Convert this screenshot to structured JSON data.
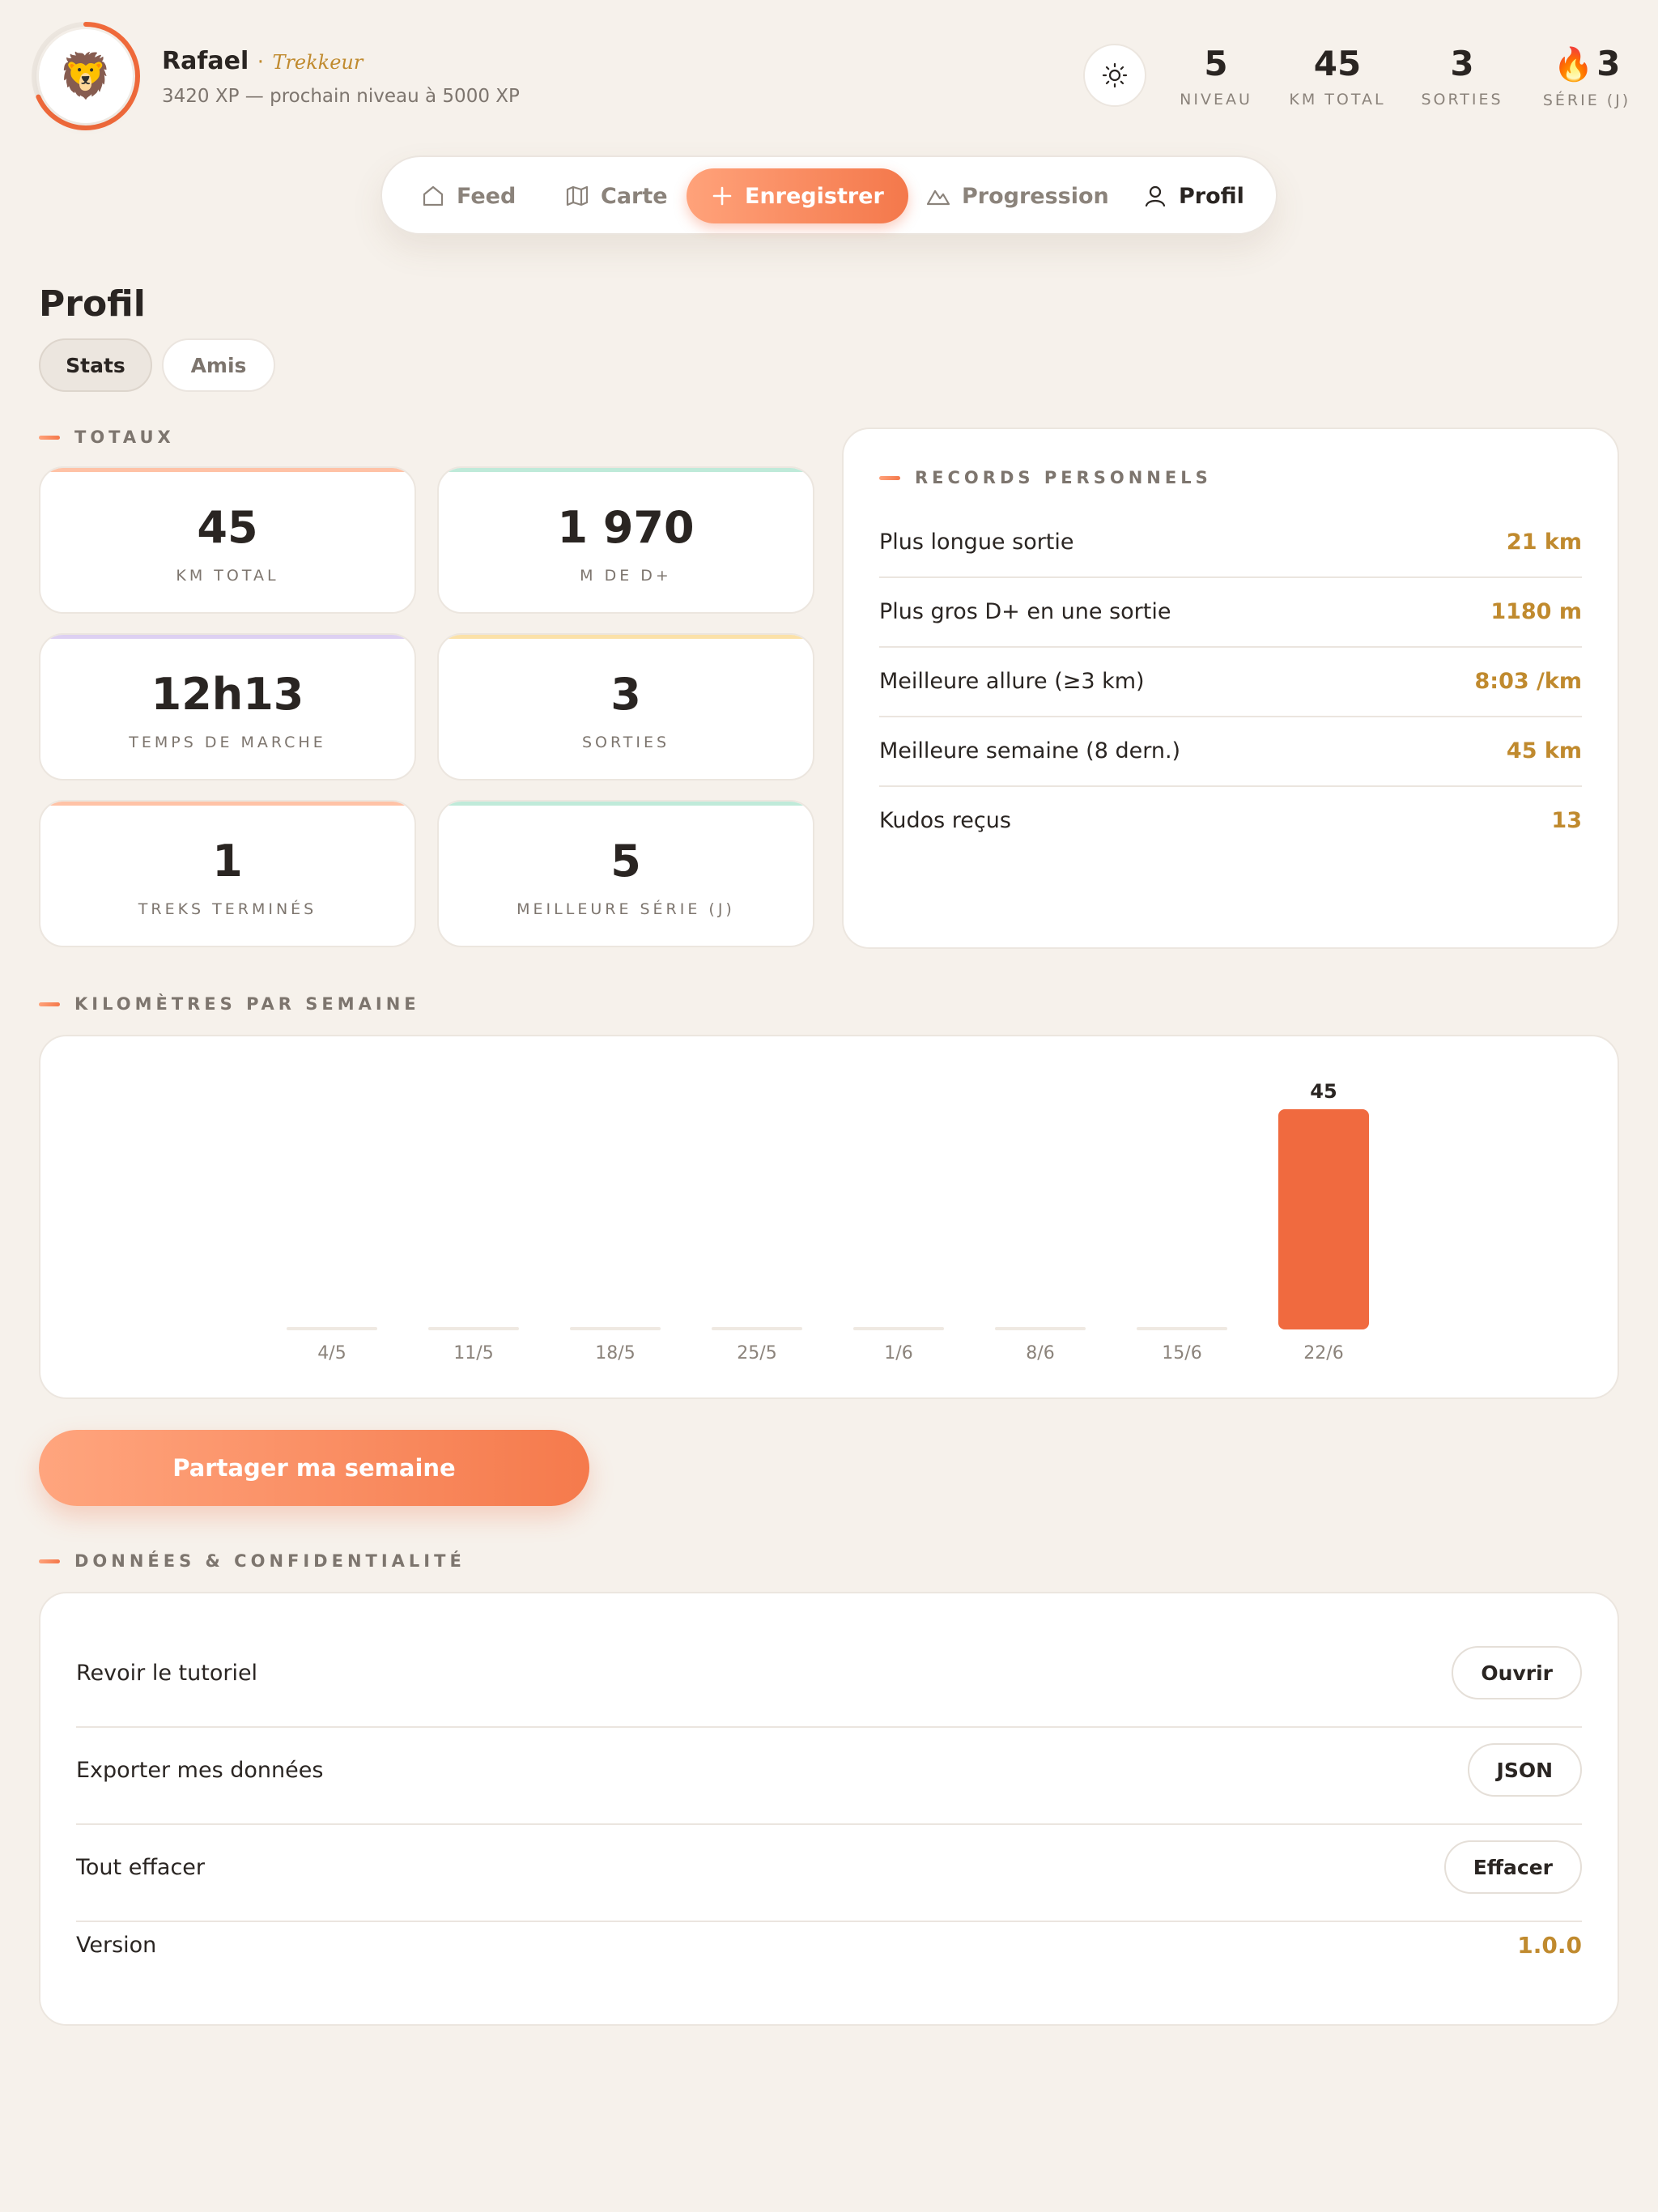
{
  "header": {
    "avatar_emoji": "🦁",
    "name": "Rafael",
    "rank_sep": "·",
    "rank": "Trekkeur",
    "xp_text": "3420 XP — prochain niveau à 5000 XP",
    "xp_progress": 0.684,
    "stats": [
      {
        "value": "5",
        "label": "NIVEAU"
      },
      {
        "value": "45",
        "label": "KM TOTAL"
      },
      {
        "value": "3",
        "label": "SORTIES"
      },
      {
        "value": "3",
        "label": "SÉRIE (J)",
        "icon": "flame-icon"
      }
    ]
  },
  "nav": {
    "items": [
      {
        "label": "Feed",
        "icon": "home-icon"
      },
      {
        "label": "Carte",
        "icon": "map-icon"
      },
      {
        "label": "Enregistrer",
        "icon": "plus-icon"
      },
      {
        "label": "Progression",
        "icon": "mountain-icon"
      },
      {
        "label": "Profil",
        "icon": "user-icon"
      }
    ]
  },
  "page": {
    "title": "Profil",
    "tabs": [
      "Stats",
      "Amis"
    ]
  },
  "totals": {
    "heading": "TOTAUX",
    "cards": [
      {
        "value": "45",
        "label": "KM TOTAL",
        "accent": "#ffc2a6"
      },
      {
        "value": "1 970",
        "label": "M DE D+",
        "accent": "#bfead9"
      },
      {
        "value": "12h13",
        "label": "TEMPS DE MARCHE",
        "accent": "#ddd0f2"
      },
      {
        "value": "3",
        "label": "SORTIES",
        "accent": "#fbe1a8"
      },
      {
        "value": "1",
        "label": "TREKS TERMINÉS",
        "accent": "#ffc2a6"
      },
      {
        "value": "5",
        "label": "MEILLEURE SÉRIE (J)",
        "accent": "#bfead9"
      }
    ]
  },
  "records": {
    "heading": "RECORDS PERSONNELS",
    "rows": [
      {
        "label": "Plus longue sortie",
        "value": "21 km"
      },
      {
        "label": "Plus gros D+ en une sortie",
        "value": "1180 m"
      },
      {
        "label": "Meilleure allure (≥3 km)",
        "value": "8:03 /km"
      },
      {
        "label": "Meilleure semaine (8 dern.)",
        "value": "45 km"
      },
      {
        "label": "Kudos reçus",
        "value": "13"
      }
    ]
  },
  "weekly": {
    "heading": "KILOMÈTRES PAR SEMAINE"
  },
  "chart_data": {
    "type": "bar",
    "categories": [
      "4/5",
      "11/5",
      "18/5",
      "25/5",
      "1/6",
      "8/6",
      "15/6",
      "22/6"
    ],
    "values": [
      0,
      0,
      0,
      0,
      0,
      0,
      0,
      45
    ],
    "data_labels": [
      "",
      "",
      "",
      "",
      "",
      "",
      "",
      "45"
    ],
    "ylim": [
      0,
      45
    ],
    "bar_color": "#f06a3f",
    "empty_color": "#efe9e2",
    "grid": false
  },
  "share": {
    "label": "Partager ma semaine"
  },
  "privacy": {
    "heading": "DONNÉES & CONFIDENTIALITÉ",
    "rows": [
      {
        "label": "Revoir le tutoriel",
        "action": "Ouvrir"
      },
      {
        "label": "Exporter mes données",
        "action": "JSON"
      },
      {
        "label": "Tout effacer",
        "action": "Effacer"
      },
      {
        "label": "Version",
        "value": "1.0.0"
      }
    ]
  }
}
